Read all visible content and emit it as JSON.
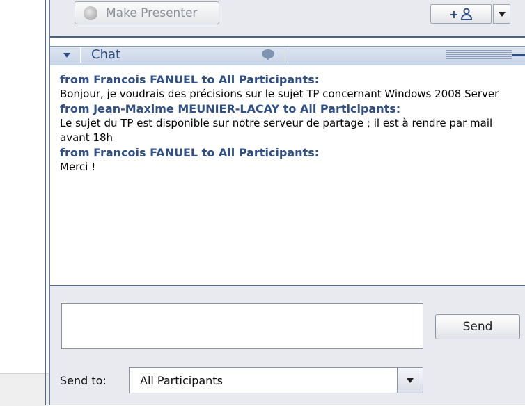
{
  "presenter_bar": {
    "make_presenter_label": "Make Presenter",
    "add_user_label": "+"
  },
  "chat": {
    "title": "Chat",
    "messages": [
      {
        "from": "from Francois FANUEL to All Participants:",
        "text": "Bonjour, je voudrais des précisions sur le sujet TP concernant Windows 2008 Server"
      },
      {
        "from": "from Jean-Maxime MEUNIER-LACAY to All Participants:",
        "text": "Le sujet du TP est disponible sur notre serveur de partage ; il est à rendre par mail avant 18h"
      },
      {
        "from": "from Francois FANUEL to All Participants:",
        "text": "Merci !"
      }
    ]
  },
  "composer": {
    "input_value": "",
    "send_label": "Send",
    "send_to_label": "Send to:",
    "recipient_value": "All Participants"
  },
  "colors": {
    "sender_blue": "#2f4f85",
    "header_bg": "#c7d3e6",
    "panel_bg": "#e9eaf0"
  }
}
